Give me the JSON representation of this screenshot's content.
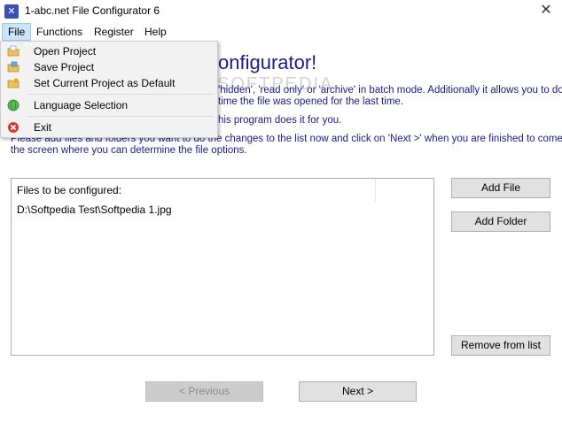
{
  "window": {
    "title": "1-abc.net File Configurator 6",
    "close_glyph": "✕",
    "app_icon": "tools-icon"
  },
  "menu": {
    "file": "File",
    "functions": "Functions",
    "register": "Register",
    "help": "Help"
  },
  "file_menu": {
    "items": [
      {
        "label": "Open Project",
        "icon": "folder-open-icon"
      },
      {
        "label": "Save Project",
        "icon": "folder-save-icon"
      },
      {
        "label": "Set Current Project as Default",
        "icon": "folder-default-icon"
      },
      {
        "label": "Language Selection",
        "icon": "globe-icon"
      },
      {
        "label": "Exit",
        "icon": "exit-icon"
      }
    ]
  },
  "content": {
    "heading": "onfigurator!",
    "line1": "'hidden', 'read only' or 'archive' in batch mode. Additionally it allows you to do",
    "line2": "time the file was opened for the last time.",
    "line3": "his program does it for you.",
    "instructions_1": "Please add files and folders you want to do the changes to the list now and click on 'Next >' when you are finished to come to",
    "instructions_2": "the screen where you can determine the file options.",
    "watermark": "SOFTPEDIA"
  },
  "file_list": {
    "header": "Files to be configured:",
    "rows": [
      "D:\\Softpedia Test\\Softpedia 1.jpg"
    ]
  },
  "buttons": {
    "add_file": "Add File",
    "add_folder": "Add Folder",
    "remove": "Remove from list",
    "previous": "< Previous",
    "next": "Next >"
  },
  "colors": {
    "accent_text": "#1a1a8c",
    "menu_highlight": "#cce4f7"
  }
}
